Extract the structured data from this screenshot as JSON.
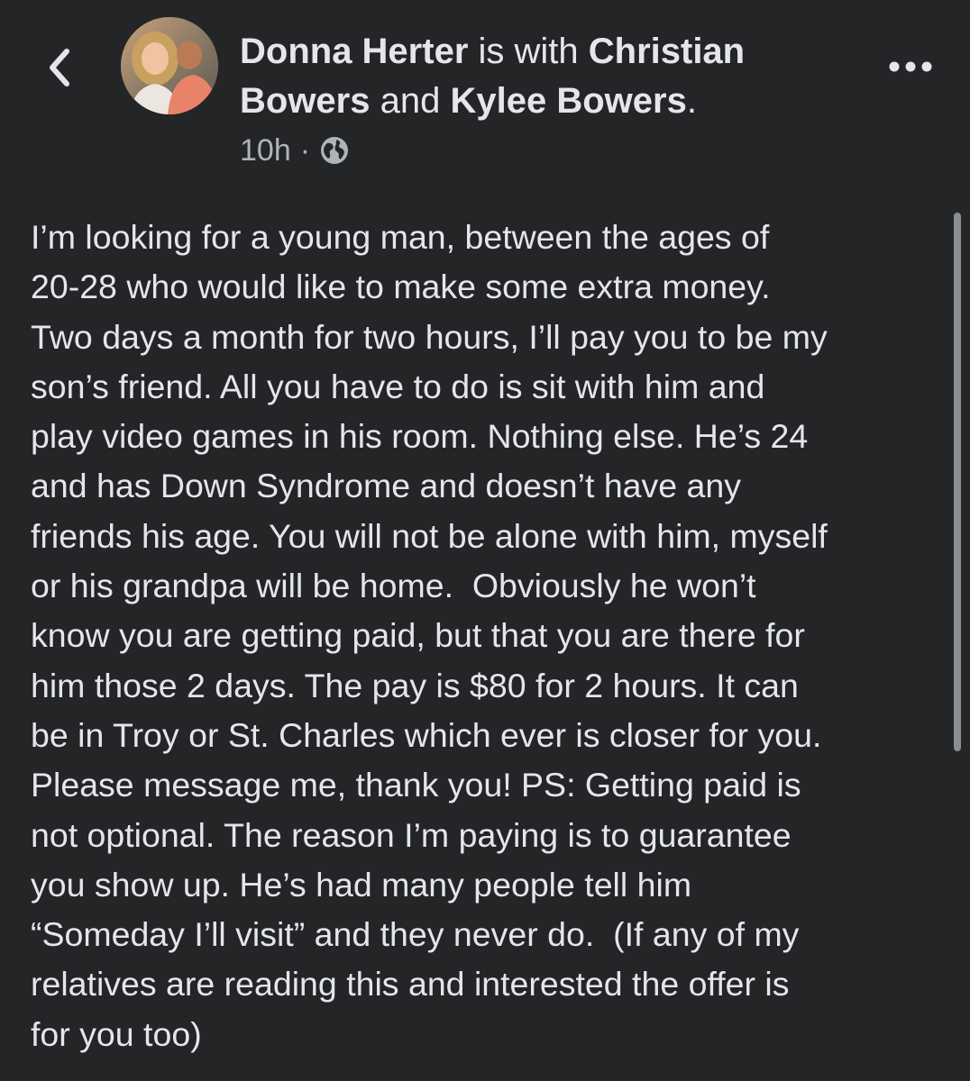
{
  "header": {
    "author": "Donna Herter",
    "with_text": " is with ",
    "tagged_1": "Christian",
    "tagged_1b": "Bowers",
    "and_text": " and ",
    "tagged_2": "Kylee Bowers",
    "end_punct": ".",
    "timestamp": "10h",
    "separator": "·",
    "privacy_icon": "globe-icon",
    "back_icon": "chevron-left-icon",
    "more_icon": "more-horizontal-icon"
  },
  "post": {
    "lines": [
      "I’m looking for a young man, between the ages of",
      "20-28 who would like to make some extra money.",
      "Two days a month for two hours, I’ll pay you to be my",
      "son’s friend. All you have to do is sit with him and",
      "play video games in his room. Nothing else. He’s 24",
      "and has Down Syndrome and doesn’t have any",
      "friends his age. You will not be alone with him, myself",
      "or his grandpa will be home.  Obviously he won’t",
      "know you are getting paid, but that you are there for",
      "him those 2 days. The pay is $80 for 2 hours. It can",
      "be in Troy or St. Charles which ever is closer for you.",
      "Please message me, thank you! PS: Getting paid is",
      "not optional. The reason I’m paying is to guarantee",
      "you show up. He’s had many people tell him",
      "“Someday I’ll visit” and they never do.  (If any of my",
      "relatives are reading this and interested the offer is",
      "for you too)"
    ]
  },
  "colors": {
    "background": "#242526",
    "primary_text": "#e4e6eb",
    "secondary_text": "#b0b3b8",
    "scrollbar": "#8a8d91"
  }
}
